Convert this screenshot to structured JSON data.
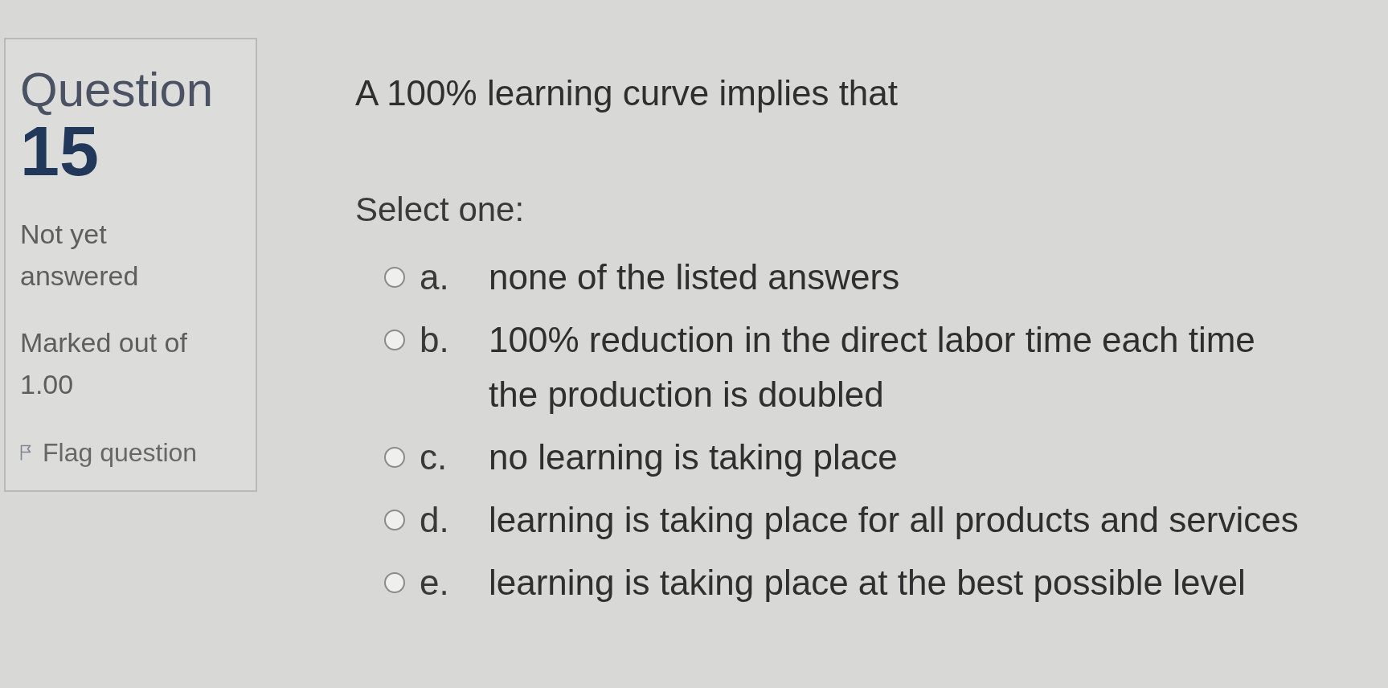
{
  "question_info": {
    "title": "Question",
    "number": "15",
    "status": "Not yet answered",
    "marks": "Marked out of 1.00",
    "flag": {
      "label": "Flag question",
      "flagged": false
    }
  },
  "question": {
    "text": "A 100% learning curve implies that",
    "prompt": "Select one:",
    "options": [
      {
        "letter": "a.",
        "text": "none of the listed answers",
        "selected": false
      },
      {
        "letter": "b.",
        "text": "100% reduction in the direct labor time each time the production is doubled",
        "selected": false
      },
      {
        "letter": "c.",
        "text": "no learning is taking place",
        "selected": false
      },
      {
        "letter": "d.",
        "text": "learning is taking place for all products and services",
        "selected": false
      },
      {
        "letter": "e.",
        "text": "learning is taking place at the best possible level",
        "selected": false
      }
    ]
  }
}
